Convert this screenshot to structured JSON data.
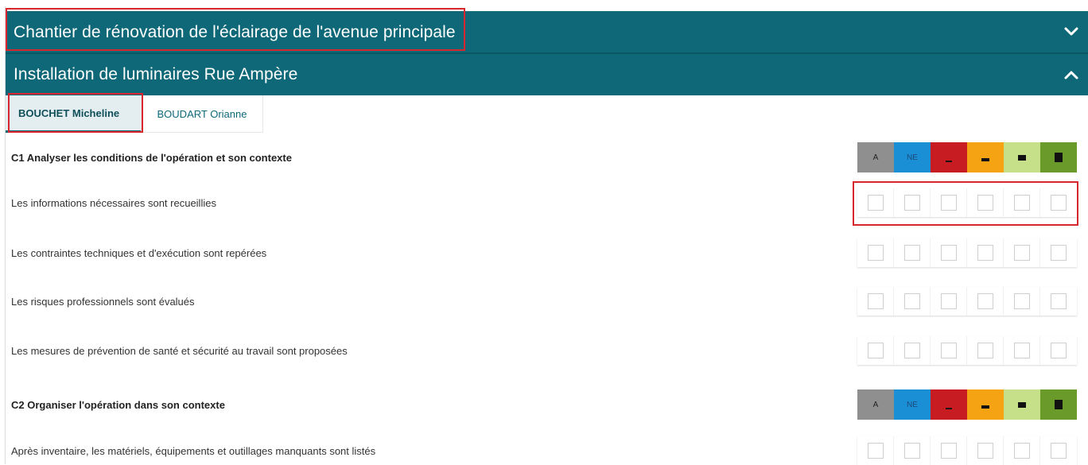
{
  "accordion": {
    "chantier_title": "Chantier de rénovation de l'éclairage de l'avenue principale",
    "installation_title": "Installation de luminaires Rue Ampère"
  },
  "tabs": [
    {
      "label": "BOUCHET Micheline",
      "active": true
    },
    {
      "label": "BOUDART Orianne",
      "active": false
    }
  ],
  "scale_labels": {
    "a": "A",
    "ne": "NE"
  },
  "colors": {
    "header": "#0e6878",
    "highlight": "#d8252e",
    "scale_a": "#8f8f8f",
    "scale_ne": "#1b8fd6",
    "scale_1": "#c71d22",
    "scale_2": "#f6a313",
    "scale_3": "#c6e08a",
    "scale_4": "#6a9a2a"
  },
  "sections": [
    {
      "title": "C1 Analyser les conditions de l'opération et son contexte",
      "criteria": [
        "Les informations nécessaires sont recueillies",
        "Les contraintes techniques et d'exécution sont repérées",
        "Les risques professionnels sont évalués",
        "Les mesures de prévention de santé et sécurité au travail sont proposées"
      ]
    },
    {
      "title": "C2 Organiser l'opération dans son contexte",
      "criteria": [
        "Après inventaire, les matériels, équipements et outillages manquants sont listés"
      ]
    }
  ]
}
